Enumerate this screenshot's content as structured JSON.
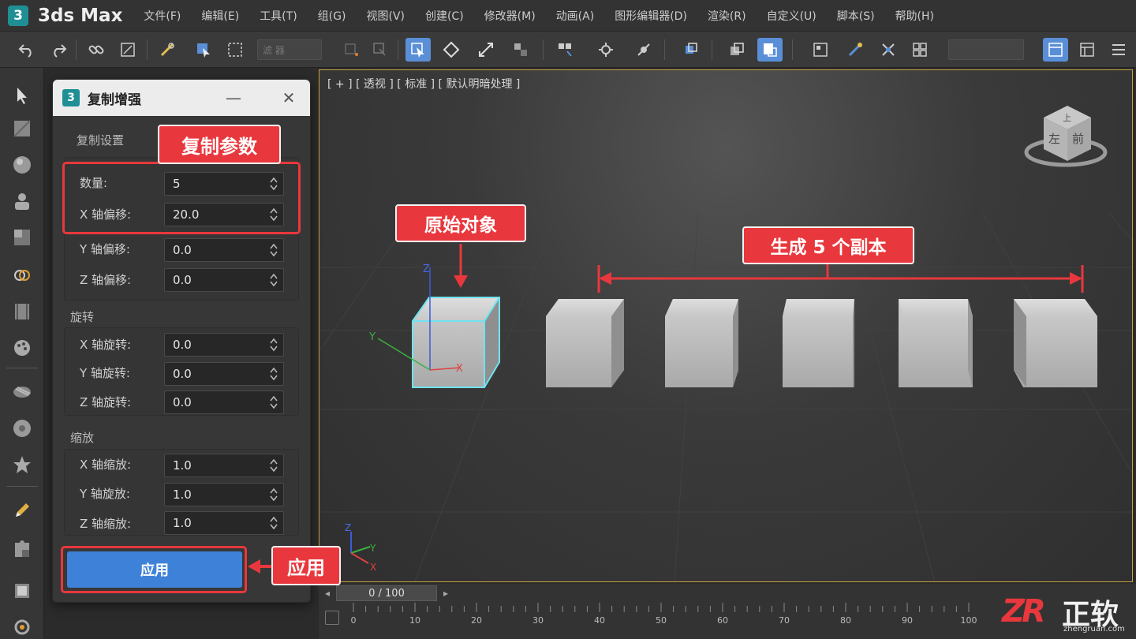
{
  "app": {
    "logo": "3",
    "name": "3ds Max"
  },
  "menu": [
    "文件(F)",
    "编辑(E)",
    "工具(T)",
    "组(G)",
    "视图(V)",
    "创建(C)",
    "修改器(M)",
    "动画(A)",
    "图形编辑器(D)",
    "渲染(R)",
    "自定义(U)",
    "脚本(S)",
    "帮助(H)"
  ],
  "toolbar": {
    "selection_filter": "滤 器"
  },
  "panel": {
    "logo": "3",
    "title": "复制增强",
    "minimize": "—",
    "close": "✕",
    "sections": {
      "copy": "复制设置",
      "rotate": "旋转",
      "scale": "缩放"
    },
    "rows": {
      "count": {
        "label": "数量:",
        "value": "5"
      },
      "x_offset": {
        "label": "X 轴偏移:",
        "value": "20.0"
      },
      "y_offset": {
        "label": "Y 轴偏移:",
        "value": "0.0"
      },
      "z_offset": {
        "label": "Z 轴偏移:",
        "value": "0.0"
      },
      "x_rot": {
        "label": "X 轴旋转:",
        "value": "0.0"
      },
      "y_rot": {
        "label": "Y 轴旋转:",
        "value": "0.0"
      },
      "z_rot": {
        "label": "Z 轴旋转:",
        "value": "0.0"
      },
      "x_scale": {
        "label": "X 轴缩放:",
        "value": "1.0"
      },
      "y_scale": {
        "label": "Y 轴旋放:",
        "value": "1.0"
      },
      "z_scale": {
        "label": "Z 轴缩放:",
        "value": "1.0"
      }
    },
    "apply": "应用"
  },
  "callouts": {
    "params": "复制参数",
    "original": "原始对象",
    "copies": "生成 5 个副本",
    "apply": "应用"
  },
  "viewport": {
    "label": "[ + ] [ 透视 ] [ 标准 ] [ 默认明暗处理 ]",
    "viewcube_faces": {
      "top": "上",
      "left": "左",
      "front": "前"
    },
    "axes": {
      "x": "X",
      "y": "Y",
      "z": "Z"
    }
  },
  "timeline": {
    "frame": "0 / 100",
    "prev": "◂",
    "next": "▸",
    "ticks": [
      "0",
      "10",
      "20",
      "30",
      "40",
      "50",
      "60",
      "70",
      "80",
      "90",
      "100"
    ]
  },
  "watermark": {
    "logo": "ZR",
    "text": "正软",
    "url": "zhengruan.com"
  },
  "colors": {
    "accent": "#3d82d8",
    "callout": "#e8383d",
    "selection": "#6fe3f0",
    "app_teal": "#1f8f95"
  }
}
